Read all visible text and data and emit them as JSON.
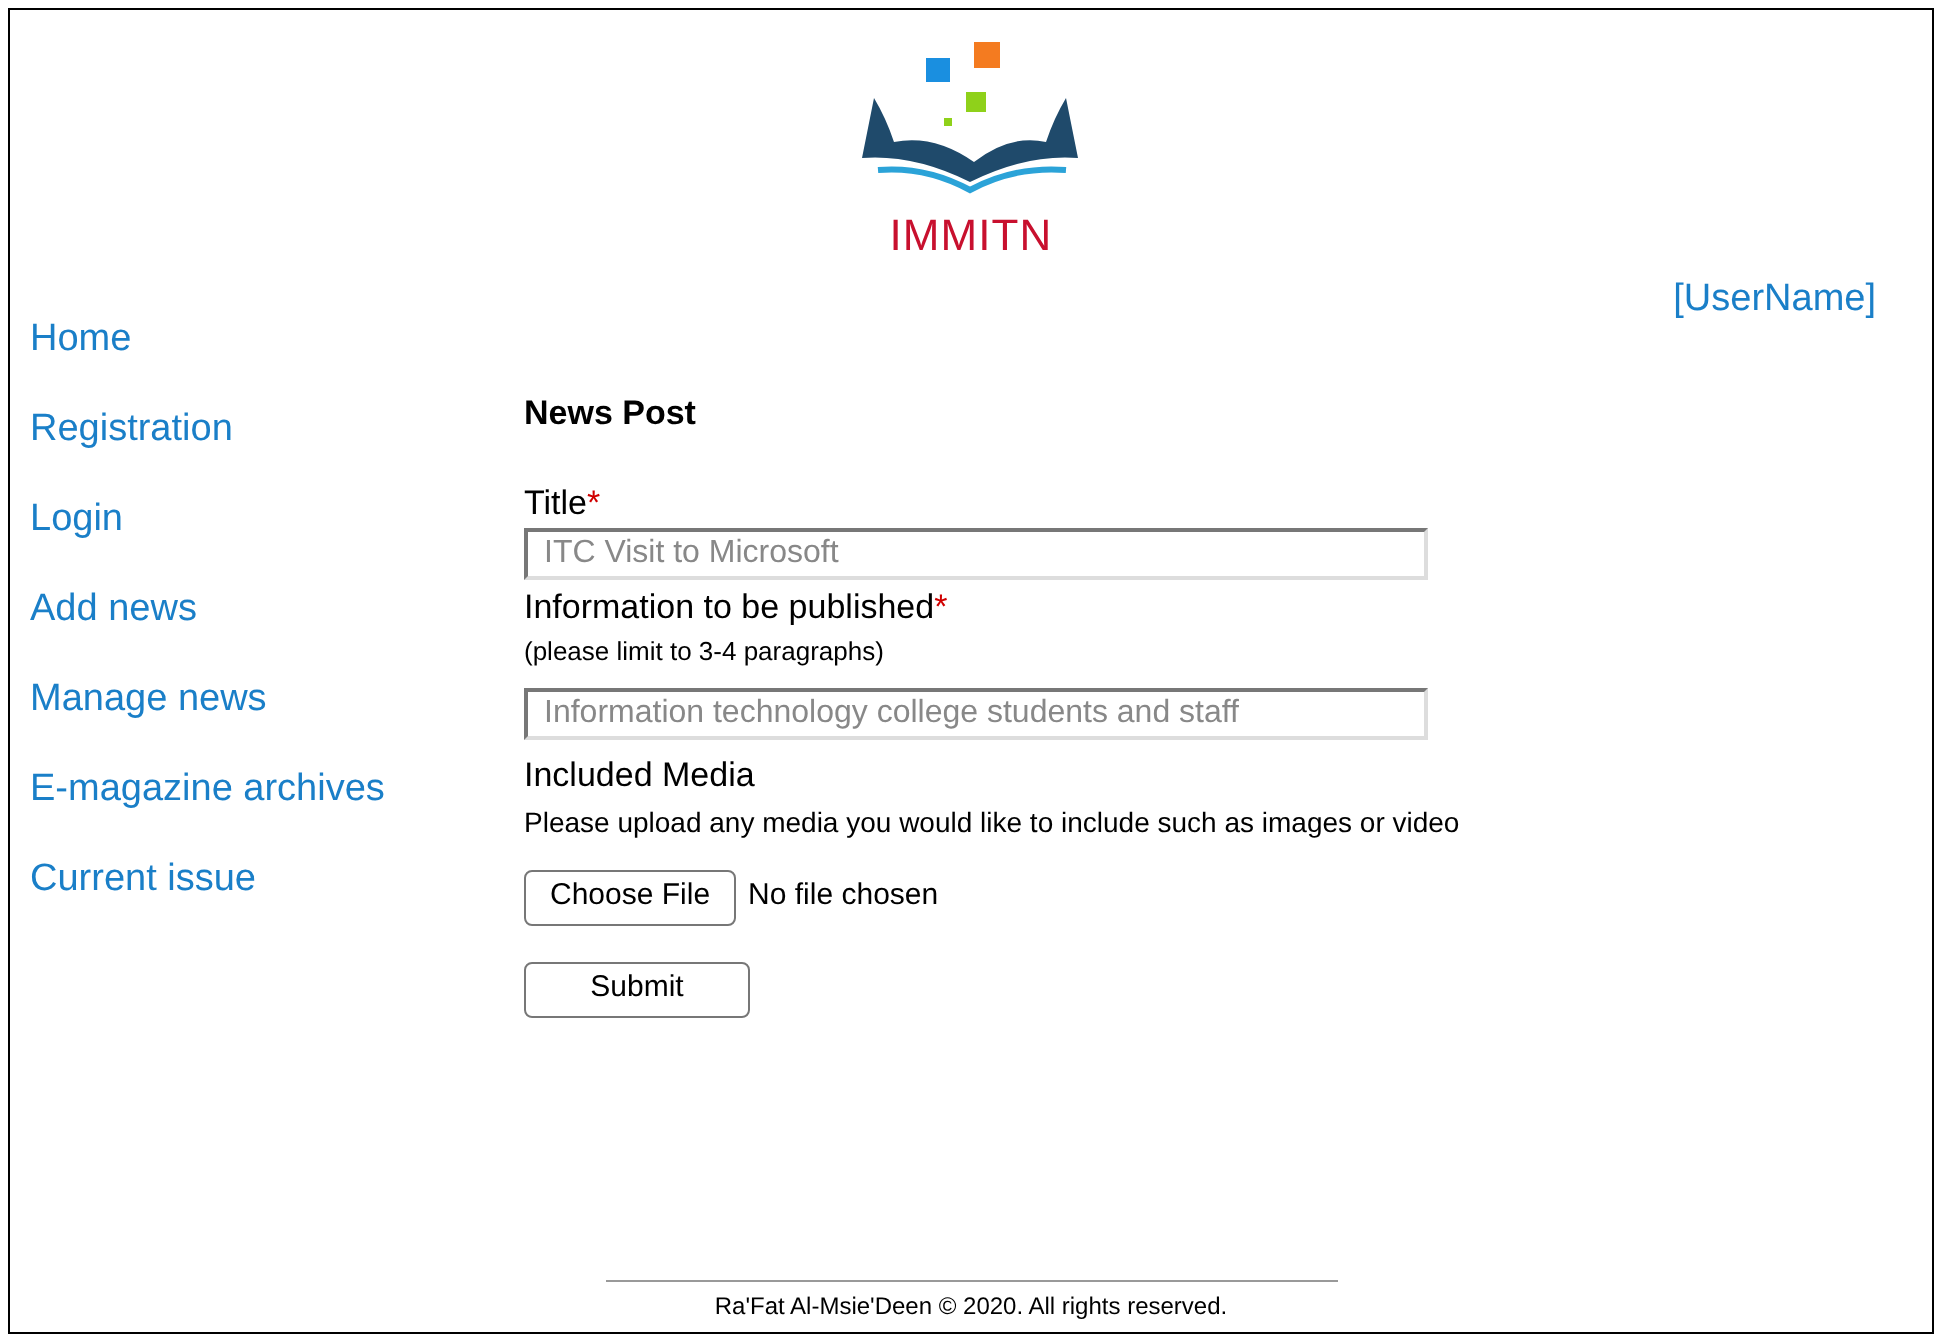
{
  "logo": {
    "text": "IMMITN"
  },
  "user": {
    "name": "[UserName]"
  },
  "nav": [
    {
      "label": "Home"
    },
    {
      "label": "Registration"
    },
    {
      "label": "Login"
    },
    {
      "label": "Add news"
    },
    {
      "label": "Manage news"
    },
    {
      "label": "E-magazine archives"
    },
    {
      "label": "Current issue"
    }
  ],
  "form": {
    "heading": "News Post",
    "fields": [
      {
        "label": "Title",
        "required_mark": "*",
        "placeholder": "ITC Visit to Microsoft"
      },
      {
        "label": "Information to be published",
        "required_mark": "*",
        "hint": "(please limit to 3-4 paragraphs)",
        "placeholder": "Information technology college students and staff"
      }
    ],
    "media": {
      "label": "Included Media",
      "hint": "Please upload any media you would like to include such as images or video",
      "button": "Choose File",
      "status": "No file chosen"
    },
    "submit": "Submit"
  },
  "footer": {
    "text": "Ra'Fat Al-Msie'Deen © 2020. All rights reserved."
  }
}
